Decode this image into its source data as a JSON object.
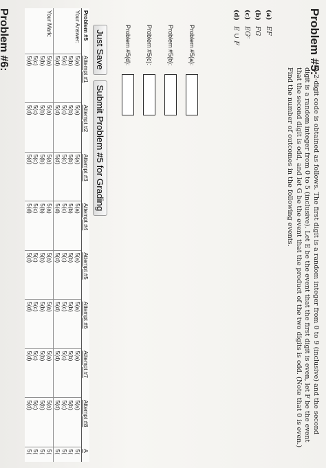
{
  "problem": {
    "title": "Problem #5:",
    "statement": [
      "A 2-digit code is obtained as follows. The first digit is a random integer from 0 to 9 (inclusive) and the second",
      "digit is a random integer from 0 to 5 (inclusive). Let E be the event that the first digit is even, let F be the event",
      "that the second digit is odd, and let G be the event that the product of the two digits is odd. (Note that 0 is even.)",
      "Find the number of outcomes in the following events."
    ],
    "parts": [
      {
        "label": "(a)",
        "expr": "EF"
      },
      {
        "label": "(b)",
        "expr": "FG"
      },
      {
        "label": "(c)",
        "expr": "EGᶜ"
      },
      {
        "label": "(d)",
        "expr": "E ∪ F"
      }
    ]
  },
  "answers": [
    {
      "label": "Problem #5(a):",
      "value": ""
    },
    {
      "label": "Problem #5(b):",
      "value": ""
    },
    {
      "label": "Problem #5(c):",
      "value": ""
    },
    {
      "label": "Problem #5(d):",
      "value": ""
    }
  ],
  "buttons": {
    "save": "Just Save",
    "submit": "Submit Problem #5 for Grading"
  },
  "attempts_table": {
    "corner": "Problem #5",
    "headers": [
      "Attempt #1",
      "Attempt #2",
      "Attempt #3",
      "Attempt #4",
      "Attempt #5",
      "Attempt #6",
      "Attempt #7",
      "Attempt #8",
      "A"
    ],
    "your_answer_label": "Your Answer:",
    "your_mark_label": "Your Mark:",
    "cells": [
      "5(a)",
      "5(b)",
      "5(c)",
      "5(d)"
    ],
    "truncated_cell": "5("
  },
  "next_problem": "Problem #6:"
}
